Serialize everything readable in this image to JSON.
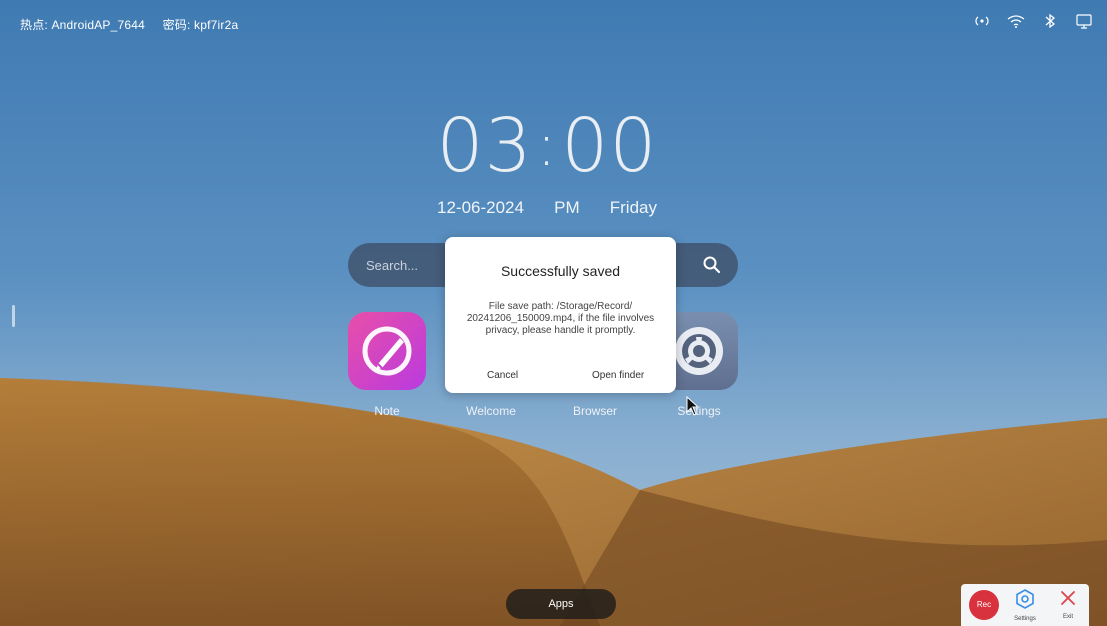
{
  "status_bar": {
    "hotspot": "热点: AndroidAP_7644",
    "password": "密码: kpf7ir2a",
    "icons": [
      "hotspot-icon",
      "wifi-icon",
      "bluetooth-icon",
      "screen-share-icon"
    ]
  },
  "clock": {
    "hours": "03",
    "minutes": "00",
    "date": "12-06-2024",
    "ampm": "PM",
    "weekday": "Friday"
  },
  "search": {
    "placeholder": "Search..."
  },
  "apps": [
    {
      "label": "Note",
      "icon": "note-pen-icon"
    },
    {
      "label": "Welcome"
    },
    {
      "label": "Browser"
    },
    {
      "label": "Settings",
      "icon": "gear-icon"
    }
  ],
  "dialog": {
    "title": "Successfully saved",
    "message": "File save path: /Storage/Record/ 20241206_150009.mp4, if the file involves privacy, please handle it promptly.",
    "cancel_label": "Cancel",
    "open_label": "Open finder"
  },
  "dock": {
    "apps_label": "Apps"
  },
  "recorder": {
    "rec_label": "Rec",
    "settings_label": "Settings",
    "exit_label": "Exit"
  },
  "colors": {
    "rec_red": "#d7323d",
    "accent_blue": "#3a8ee6"
  }
}
